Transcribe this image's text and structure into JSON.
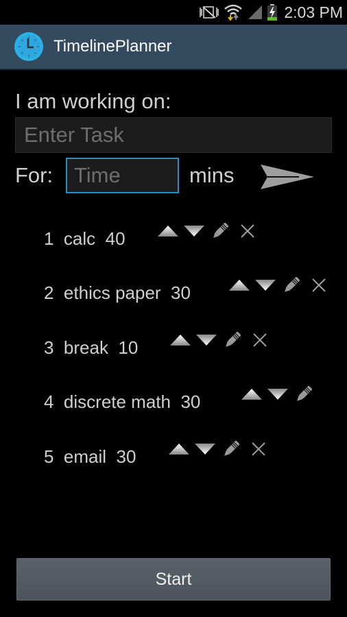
{
  "status_bar": {
    "time": "2:03 PM",
    "icons": [
      "mute-vibrate-icon",
      "wifi-icon",
      "signal-icon",
      "battery-charging-icon"
    ],
    "battery_color": "#5cb82e"
  },
  "action_bar": {
    "title": "TimelinePlanner",
    "icon": "clock-icon",
    "background": "#344a5f",
    "icon_color": "#29b3e8"
  },
  "form": {
    "task_label": "I am working on:",
    "task_placeholder": "Enter Task",
    "task_value": "",
    "for_label": "For:",
    "time_placeholder": "Time",
    "time_value": "",
    "mins_label": "mins",
    "submit_icon": "send-arrow-icon",
    "focus_color": "#2a8fc9"
  },
  "tasks": [
    {
      "number": "1",
      "name": "calc",
      "minutes": "40",
      "has_delete": true
    },
    {
      "number": "2",
      "name": "ethics paper",
      "minutes": "30",
      "has_delete": true
    },
    {
      "number": "3",
      "name": "break",
      "minutes": "10",
      "has_delete": true
    },
    {
      "number": "4",
      "name": "discrete math",
      "minutes": "30",
      "has_delete": false
    },
    {
      "number": "5",
      "name": "email",
      "minutes": "30",
      "has_delete": true
    }
  ],
  "task_control_icons": {
    "move_up": "triangle-up-icon",
    "move_down": "triangle-down-icon",
    "edit": "pencil-icon",
    "delete": "close-icon"
  },
  "start_button": {
    "label": "Start"
  }
}
